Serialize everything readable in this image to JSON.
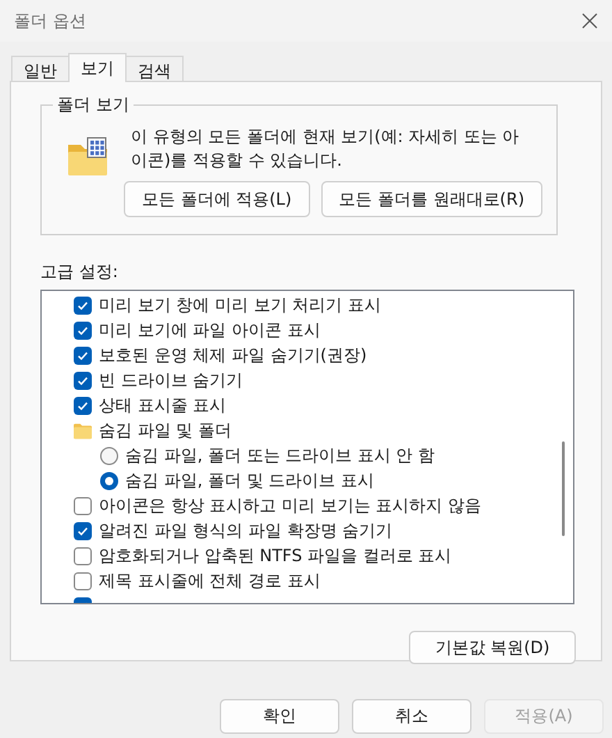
{
  "window": {
    "title": "폴더 옵션"
  },
  "tabs": [
    {
      "label": "일반",
      "selected": false
    },
    {
      "label": "보기",
      "selected": true
    },
    {
      "label": "검색",
      "selected": false
    }
  ],
  "folder_views": {
    "title": "폴더 보기",
    "description": "이 유형의 모든 폴더에 현재 보기(예: 자세히 또는 아이콘)를 적용할 수 있습니다.",
    "buttons": [
      "모든 폴더에 적용(L)",
      "모든 폴더를 원래대로(R)"
    ]
  },
  "advanced": {
    "label": "고급 설정:",
    "items": [
      {
        "kind": "checkbox",
        "label": "미리 보기 창에 미리 보기 처리기 표시",
        "checked": true
      },
      {
        "kind": "checkbox",
        "label": "미리 보기에 파일 아이콘 표시",
        "checked": true
      },
      {
        "kind": "checkbox",
        "label": "보호된 운영 체제 파일 숨기기(권장)",
        "checked": true
      },
      {
        "kind": "checkbox",
        "label": "빈 드라이브 숨기기",
        "checked": true
      },
      {
        "kind": "checkbox",
        "label": "상태 표시줄 표시",
        "checked": true
      },
      {
        "kind": "folder",
        "label": "숨김 파일 및 폴더",
        "children": [
          {
            "kind": "radio",
            "label": "숨김 파일, 폴더 또는 드라이브 표시 안 함",
            "selected": false
          },
          {
            "kind": "radio",
            "label": "숨김 파일, 폴더 및 드라이브 표시",
            "selected": true
          }
        ]
      },
      {
        "kind": "checkbox",
        "label": "아이콘은 항상 표시하고 미리 보기는 표시하지 않음",
        "checked": false
      },
      {
        "kind": "checkbox",
        "label": "알려진 파일 형식의 파일 확장명 숨기기",
        "checked": true
      },
      {
        "kind": "checkbox",
        "label": "암호화되거나 압축된 NTFS 파일을 컬러로 표시",
        "checked": false
      },
      {
        "kind": "checkbox",
        "label": "제목 표시줄에 전체 경로 표시",
        "checked": false
      },
      {
        "kind": "checkbox",
        "checked": true
      }
    ],
    "restore_button": "기본값 복원(D)"
  },
  "footer": [
    {
      "label": "확인",
      "disabled": false
    },
    {
      "label": "취소",
      "disabled": false
    },
    {
      "label": "적용(A)",
      "disabled": true
    }
  ]
}
